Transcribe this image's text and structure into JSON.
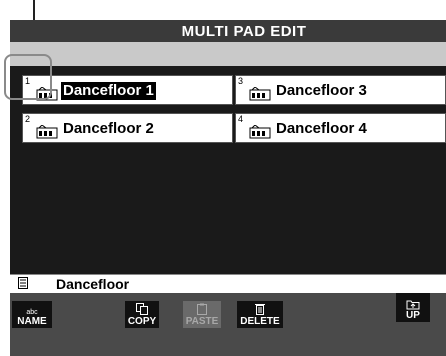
{
  "title": "MULTI PAD EDIT",
  "pads": [
    {
      "number": "1",
      "name": "Dancefloor 1",
      "selected": true
    },
    {
      "number": "3",
      "name": "Dancefloor 3",
      "selected": false
    },
    {
      "number": "2",
      "name": "Dancefloor 2",
      "selected": false
    },
    {
      "number": "4",
      "name": "Dancefloor 4",
      "selected": false
    }
  ],
  "path": {
    "label": "Dancefloor"
  },
  "buttons": {
    "name": {
      "small": "abc",
      "label": "NAME"
    },
    "copy": {
      "label": "COPY"
    },
    "paste": {
      "label": "PASTE",
      "disabled": true
    },
    "delete": {
      "label": "DELETE"
    },
    "up": {
      "label": "UP"
    }
  }
}
